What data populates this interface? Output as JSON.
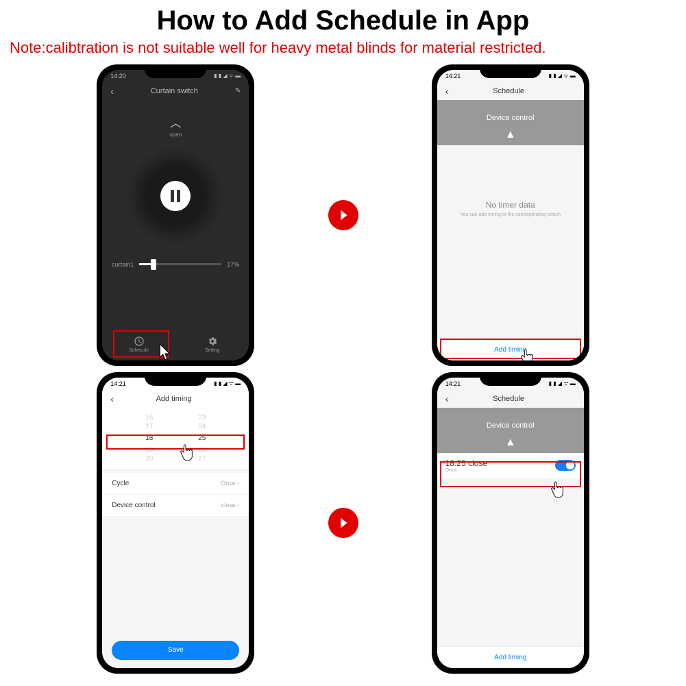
{
  "header": {
    "title": "How to Add Schedule in App",
    "note": "Note:calibtration is not suitable well for heavy metal blinds for material restricted."
  },
  "phone1": {
    "time": "14:20",
    "nav_title": "Curtain switch",
    "open_label": "open",
    "slider_label": "curtain1",
    "slider_value": "17%",
    "tab_schedule": "Schecule",
    "tab_setting": "Setting"
  },
  "phone2": {
    "time": "14:21",
    "nav_title": "Schedule",
    "section_title": "Device control",
    "empty_title": "No timer data",
    "empty_sub": "You can add timing to the corresponding switch",
    "add_timing": "Add timing"
  },
  "phone3": {
    "time": "14:21",
    "nav_title": "Add timing",
    "picker": {
      "rows": [
        [
          "16",
          "23"
        ],
        [
          "17",
          "24"
        ],
        [
          "18",
          "25"
        ],
        [
          "19",
          "26"
        ],
        [
          "20",
          "27"
        ]
      ],
      "selected_index": 2
    },
    "cycle_label": "Cycle",
    "cycle_value": "Once",
    "device_label": "Device control",
    "device_value": "close",
    "save": "Save"
  },
  "phone4": {
    "time": "14:21",
    "nav_title": "Schedule",
    "section_title": "Device control",
    "timing_text": "18:25 close",
    "timing_sub": "Once",
    "add_timing": "Add timing"
  }
}
